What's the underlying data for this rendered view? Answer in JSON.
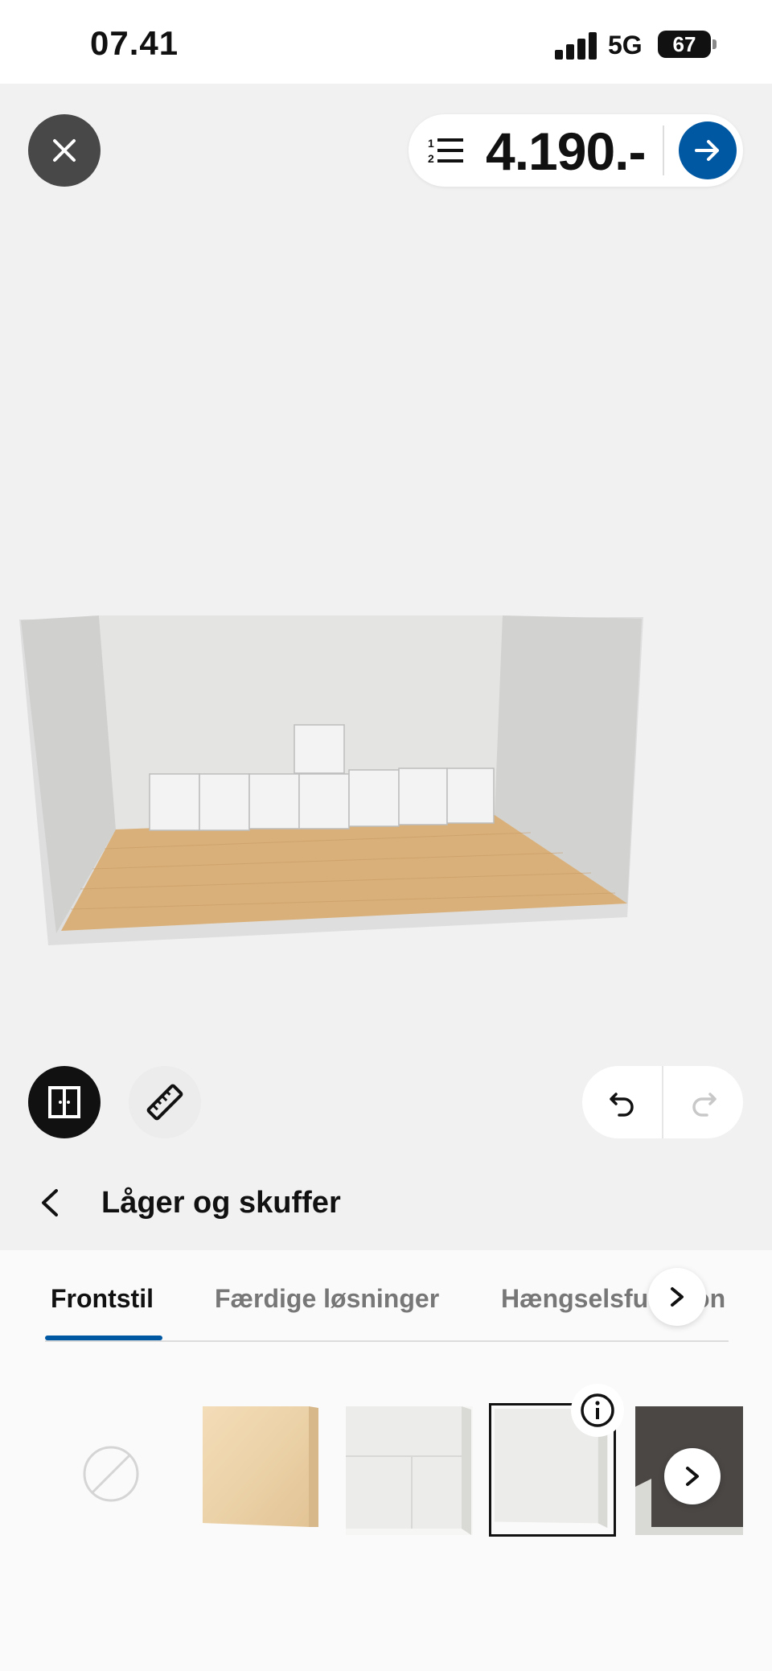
{
  "status_bar": {
    "time": "07.41",
    "network": "5G",
    "battery": "67"
  },
  "toolbar": {
    "price": "4.190.-"
  },
  "section": {
    "title": "Låger og skuffer"
  },
  "tabs": [
    {
      "label": "Frontstil",
      "active": true
    },
    {
      "label": "Færdige løsninger",
      "active": false
    },
    {
      "label": "Hængselsfunktion",
      "active": false
    }
  ],
  "swatches": [
    "no-front",
    "birch",
    "white-panel",
    "white-flat-selected",
    "dark-grey"
  ],
  "colors": {
    "accent": "#0058a3",
    "floor": "#d9b07a",
    "canvas": "#f1f1f1"
  }
}
